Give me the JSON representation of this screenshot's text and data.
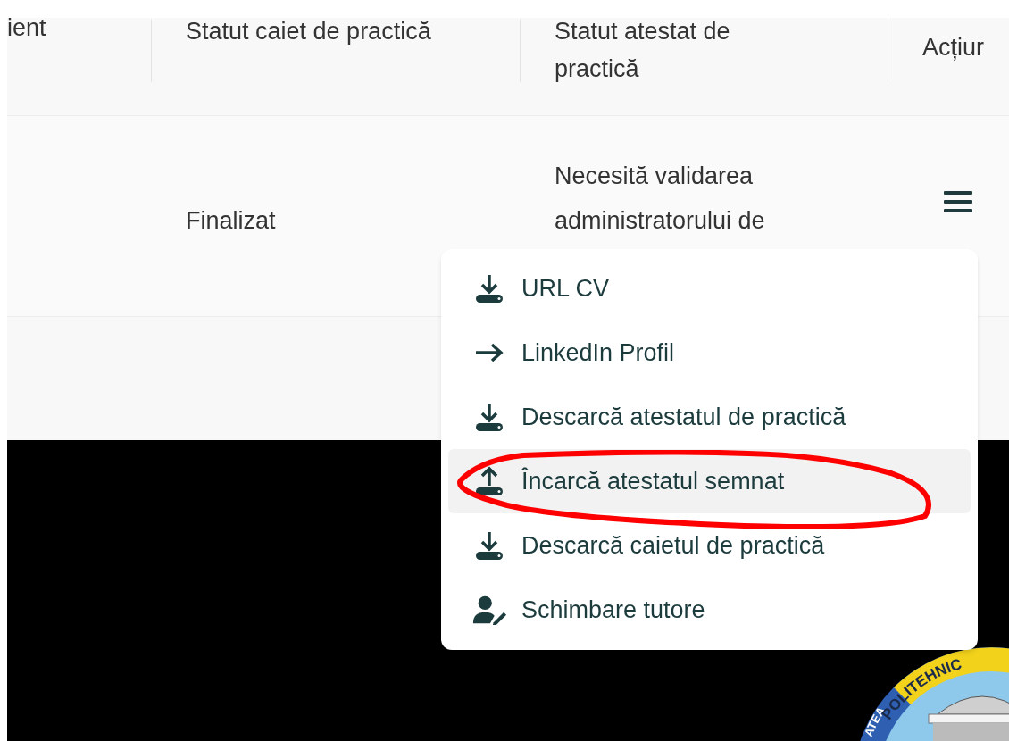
{
  "table": {
    "columns": [
      "ient",
      "Statut caiet de practică",
      "Statut atestat de practică",
      "Acțiur"
    ],
    "rows": [
      {
        "cells": [
          "",
          "Finalizat",
          "Necesită validarea administratorului de"
        ]
      }
    ]
  },
  "actions_menu": {
    "items": [
      {
        "kind": "download",
        "label": "URL CV",
        "selected": false
      },
      {
        "kind": "arrow",
        "label": "LinkedIn Profil",
        "selected": false
      },
      {
        "kind": "download",
        "label": "Descarcă atestatul de practică",
        "selected": false
      },
      {
        "kind": "upload",
        "label": "Încarcă atestatul semnat",
        "selected": true
      },
      {
        "kind": "download",
        "label": "Descarcă caietul de practică",
        "selected": false
      },
      {
        "kind": "user-edit",
        "label": "Schimbare tutore",
        "selected": false
      }
    ]
  },
  "logo": {
    "text_top": "POLITEHNIC",
    "text_left": "ATEA"
  }
}
